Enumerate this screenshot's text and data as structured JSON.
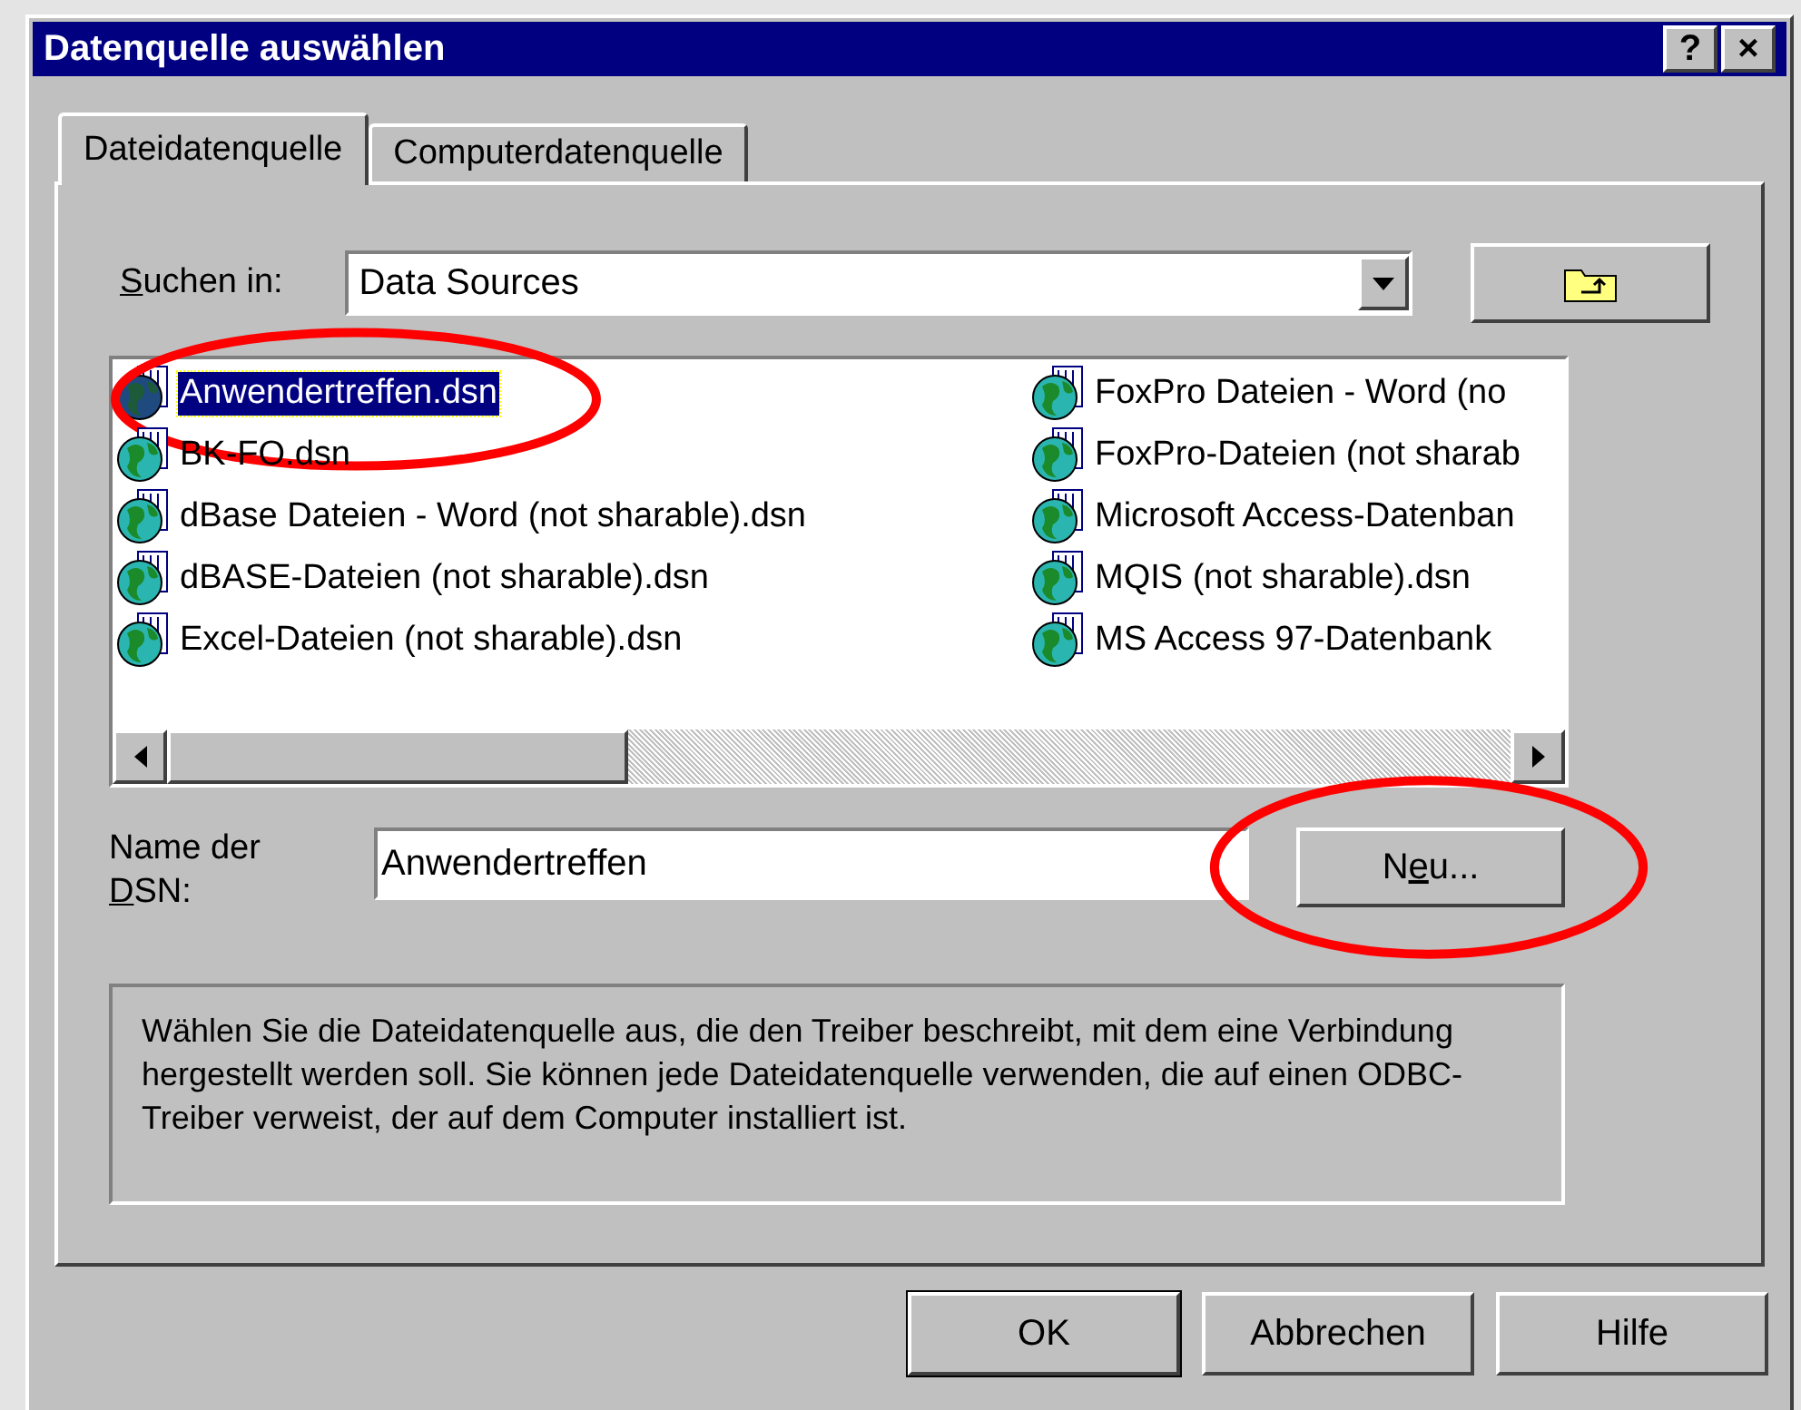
{
  "window": {
    "title": "Datenquelle auswählen",
    "title_buttons": [
      "?",
      "×"
    ]
  },
  "tabs": [
    {
      "label": "Dateidatenquelle",
      "selected": true
    },
    {
      "label": "Computerdatenquelle",
      "selected": false
    }
  ],
  "look_in": {
    "label": {
      "key": "S",
      "after": "uchen in:"
    },
    "value": "Data Sources"
  },
  "files": [
    {
      "name": "Anwendertreffen.dsn",
      "selected": true,
      "annotated": true
    },
    {
      "name": "BK-FO.dsn",
      "selected": false,
      "annotated": false
    },
    {
      "name": "dBase Dateien - Word (not sharable).dsn",
      "selected": false,
      "annotated": false
    },
    {
      "name": "dBASE-Dateien (not sharable).dsn",
      "selected": false,
      "annotated": false
    },
    {
      "name": "Excel-Dateien (not sharable).dsn",
      "selected": false,
      "annotated": false
    },
    {
      "name": "FoxPro Dateien - Word (no",
      "selected": false,
      "annotated": false
    },
    {
      "name": "FoxPro-Dateien (not sharab",
      "selected": false,
      "annotated": false
    },
    {
      "name": "Microsoft Access-Datenban",
      "selected": false,
      "annotated": false
    },
    {
      "name": "MQIS (not sharable).dsn",
      "selected": false,
      "annotated": false
    },
    {
      "name": "MS Access 97-Datenbank",
      "selected": false,
      "annotated": false
    }
  ],
  "dsn_name": {
    "label": {
      "before": "Name der\n",
      "key": "D",
      "after": "SN:"
    },
    "value": "Anwendertreffen"
  },
  "new_button": {
    "label": {
      "before": "N",
      "key": "e",
      "after": "u..."
    },
    "annotated": true
  },
  "description": "Wählen Sie die Dateidatenquelle aus, die den Treiber beschreibt, mit dem eine Verbindung hergestellt werden soll. Sie können jede Dateidatenquelle verwenden, die auf einen ODBC-Treiber verweist, der auf dem Computer installiert ist.",
  "buttons": [
    {
      "label": "OK",
      "default": true
    },
    {
      "label": "Abbrechen",
      "default": false
    },
    {
      "label": "Hilfe",
      "default": false
    }
  ]
}
